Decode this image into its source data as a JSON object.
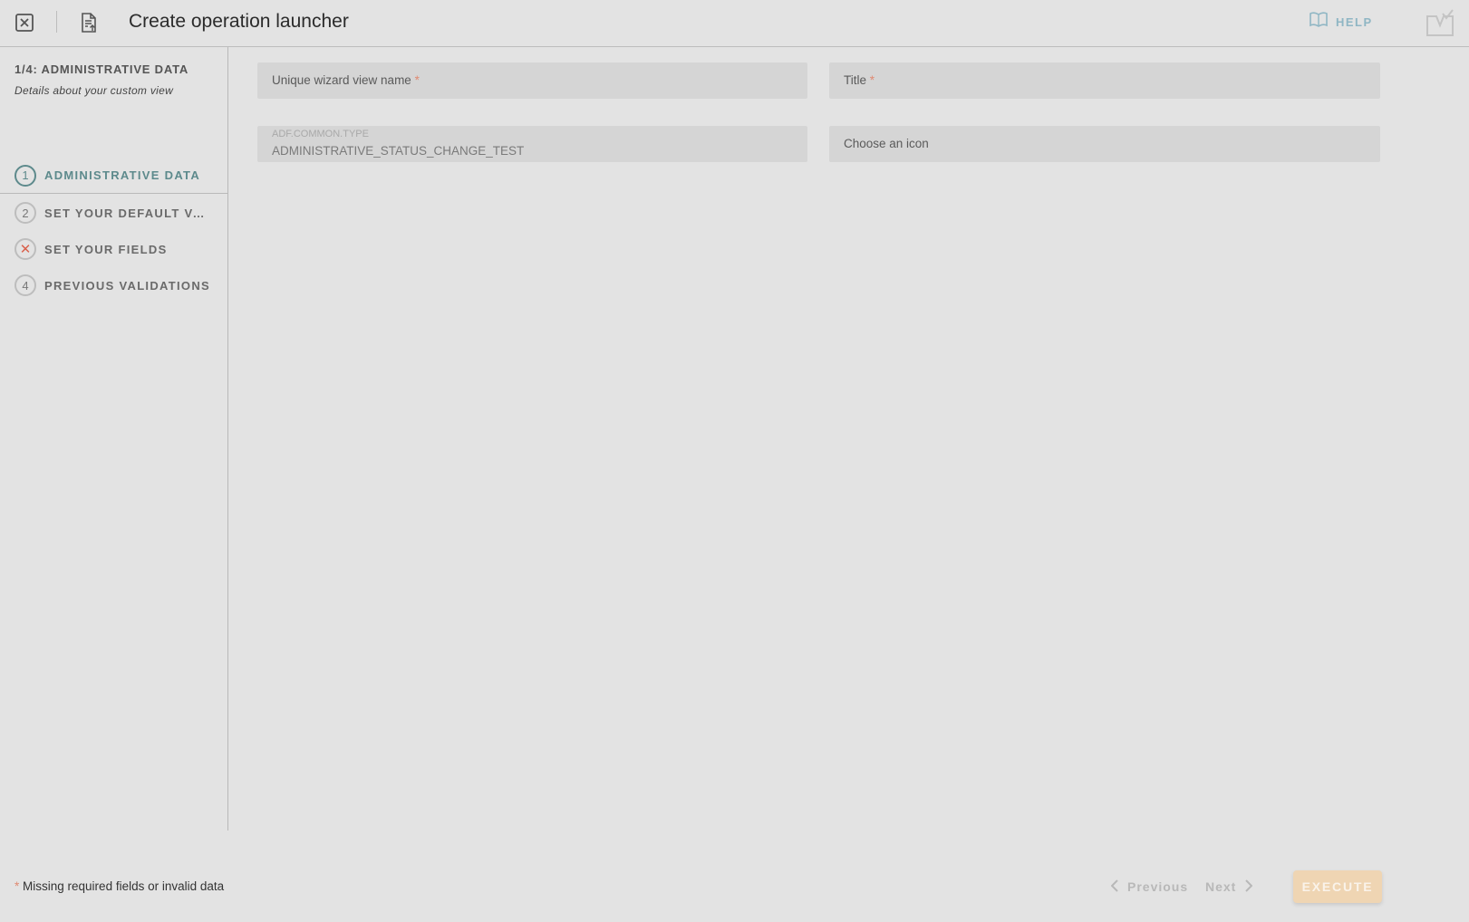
{
  "header": {
    "title": "Create operation launcher",
    "help_label": "HELP",
    "icons": [
      "close-icon",
      "document-export-icon",
      "help-book-icon",
      "tray-check-icon"
    ]
  },
  "sidebar": {
    "step_title": "1/4: ADMINISTRATIVE DATA",
    "step_subtitle": "Details about your custom view",
    "steps": [
      {
        "marker": "1",
        "label": "ADMINISTRATIVE DATA",
        "state": "active"
      },
      {
        "marker": "2",
        "label": "SET YOUR DEFAULT VALUES",
        "state": "pending"
      },
      {
        "marker": "✕",
        "label": "SET YOUR FIELDS",
        "state": "error"
      },
      {
        "marker": "4",
        "label": "PREVIOUS VALIDATIONS",
        "state": "pending"
      }
    ]
  },
  "form": {
    "wizard_name_placeholder": "Unique wizard view name",
    "title_placeholder": "Title",
    "required_mark": "*",
    "type_label": "ADF.COMMON.TYPE",
    "type_value": "ADMINISTRATIVE_STATUS_CHANGE_TEST",
    "icon_placeholder": "Choose an icon"
  },
  "footer": {
    "required_mark": "*",
    "note": "Missing required fields or invalid data",
    "previous_label": "Previous",
    "next_label": "Next",
    "execute_label": "EXECUTE"
  },
  "colors": {
    "background": "#e3e3e3",
    "accent_teal": "#5d8a8c",
    "error_red": "#d9614c",
    "help_blue": "#8fb6c4",
    "execute_bg": "#efd5b3"
  }
}
